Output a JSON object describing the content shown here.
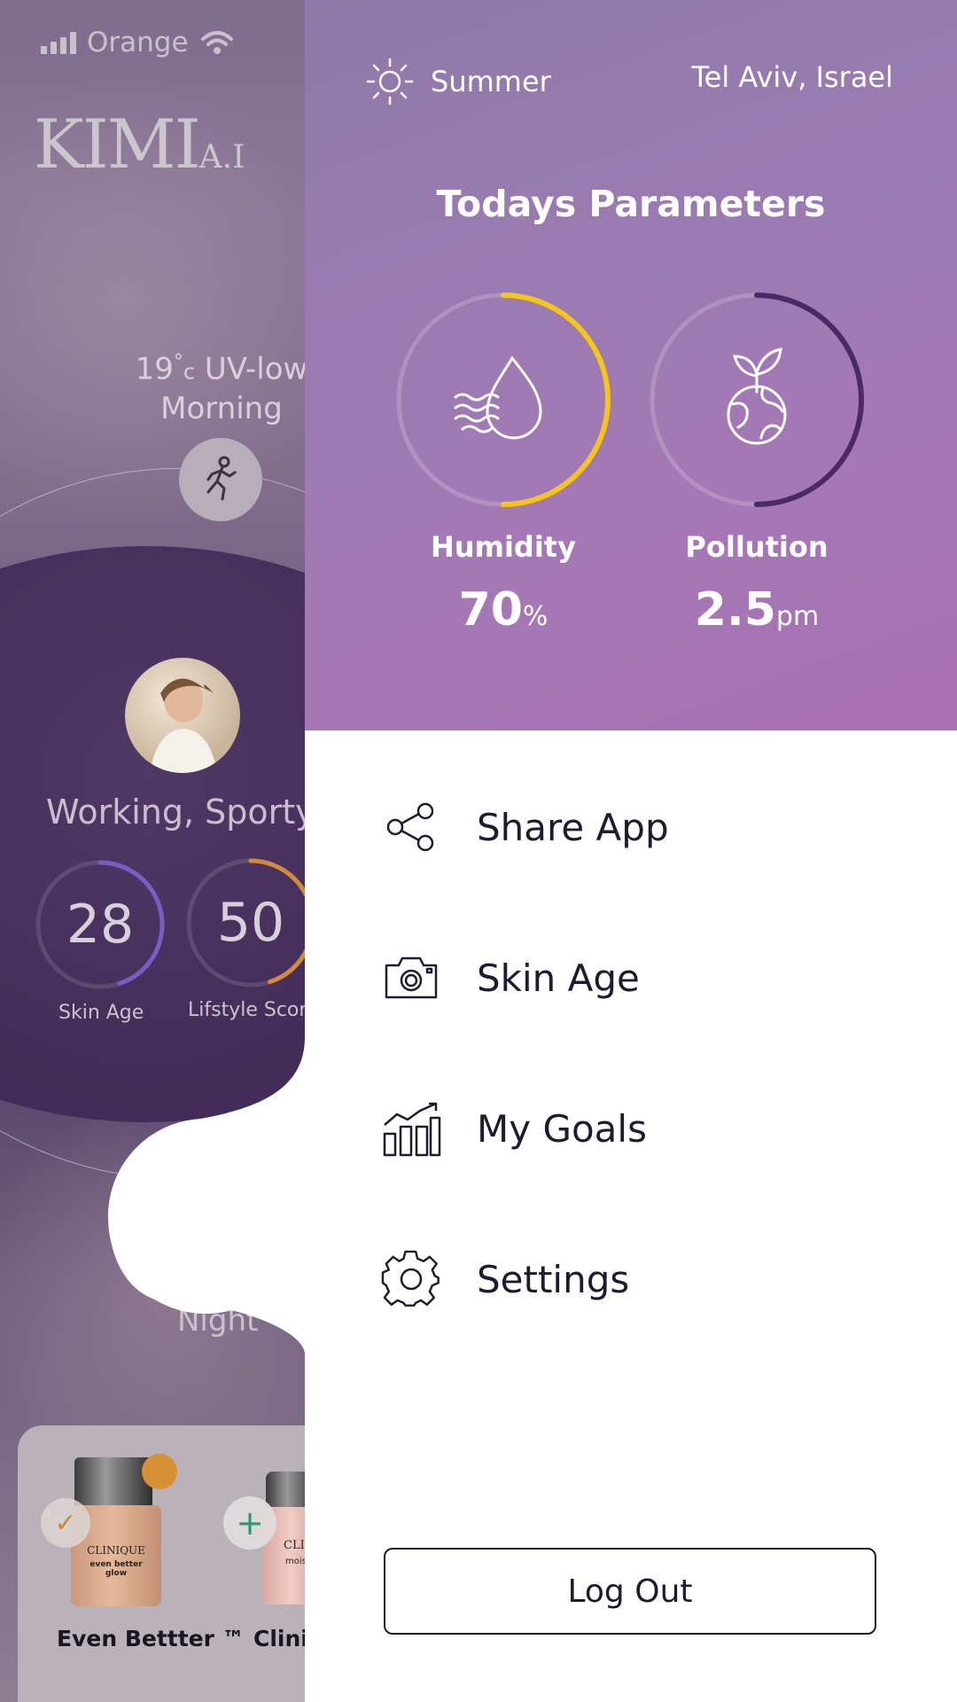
{
  "status_bar": {
    "carrier": "Orange"
  },
  "background_app": {
    "logo_main": "KIMI",
    "logo_sub": "A.I",
    "weather_line1": "19",
    "weather_deg": "°",
    "weather_c": "c",
    "weather_uv": " UV-low",
    "weather_line2": "Morning",
    "profile_text": "Working, Sporty",
    "skin_age": {
      "value": "28",
      "label": "Skin Age",
      "fraction": 0.45
    },
    "lifestyle": {
      "value": "50",
      "label": "Lifstyle Score",
      "fraction": 0.45
    },
    "night_label": "Night",
    "products": [
      {
        "name": "Even Bettter ™",
        "brand": "CLINIQUE",
        "subtitle": "even better glow"
      },
      {
        "name": "Clinique",
        "brand": "CLINIQUE",
        "subtitle": "moisture"
      }
    ],
    "colors": {
      "skin_age_ring": "#7b5bc4",
      "lifestyle_ring": "#d28a3c"
    }
  },
  "drawer": {
    "season": "Summer",
    "season_icon": "sun-icon",
    "location": "Tel Aviv, Israel",
    "title": "Todays Parameters",
    "humidity": {
      "label": "Humidity",
      "value": "70",
      "unit": "%",
      "fraction": 0.5,
      "icon": "humidity-drop-icon",
      "color": "#f5c518"
    },
    "pollution": {
      "label": "Pollution",
      "value": "2.5",
      "unit": "pm",
      "fraction": 0.5,
      "icon": "earth-sprout-icon",
      "color": "#4a2a66"
    },
    "menu": [
      {
        "label": "Share App",
        "icon": "share-icon"
      },
      {
        "label": "Skin Age",
        "icon": "camera-icon"
      },
      {
        "label": "My Goals",
        "icon": "growth-chart-icon"
      },
      {
        "label": "Settings",
        "icon": "gear-icon"
      }
    ],
    "logout_label": "Log Out"
  }
}
